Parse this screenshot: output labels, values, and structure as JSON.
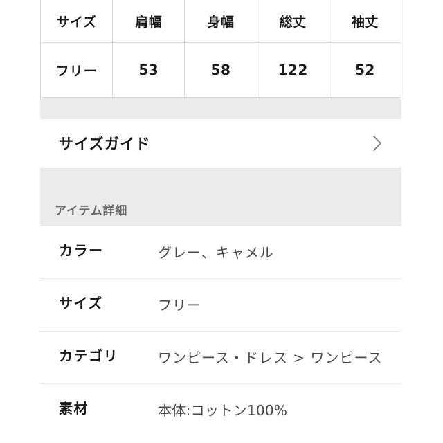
{
  "size_table": {
    "headers": [
      "サイズ",
      "肩幅",
      "身幅",
      "総丈",
      "袖丈"
    ],
    "rows": [
      [
        "フリー",
        "53",
        "58",
        "122",
        "52"
      ]
    ]
  },
  "size_guide": {
    "label": "サイズガイド",
    "chevron_icon": "chevron-right-icon"
  },
  "item_details": {
    "section_title": "アイテム詳細",
    "rows": [
      {
        "label": "カラー",
        "value": "グレー、キャメル"
      },
      {
        "label": "サイズ",
        "value": "フリー"
      },
      {
        "label": "カテゴリ",
        "value": "ワンピース・ドレス > ワンピース"
      },
      {
        "label": "素材",
        "value": "本体:コットン100%"
      }
    ]
  },
  "colors": {
    "band_gray": "#ebebeb",
    "table_border": "#d8d8d8",
    "divider": "#e8e8e8",
    "label_text": "#1a1a1a",
    "value_text": "#4a4a4a",
    "section_title_text": "#6a6a6a",
    "page_background": "#ffffff"
  }
}
